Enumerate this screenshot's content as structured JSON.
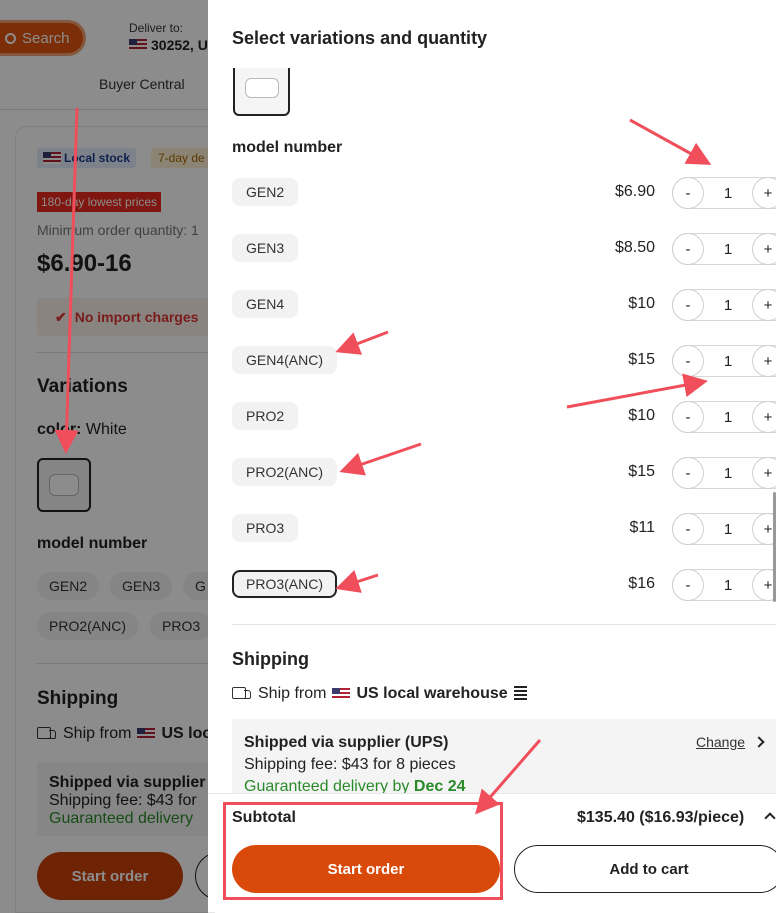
{
  "background": {
    "search_label": "Search",
    "deliver_label": "Deliver to:",
    "deliver_value": "30252, U",
    "buyer_central": "Buyer Central",
    "badge_local": "Local stock",
    "badge_days": "7-day de",
    "badge_lowest": "180-day lowest prices",
    "min_order": "Minimum order quantity: 1",
    "price_range": "$6.90-16",
    "no_import": "No import charges",
    "variations_title": "Variations",
    "color_label": "color:",
    "color_value": "White",
    "model_title": "model number",
    "chips": [
      "GEN2",
      "GEN3",
      "G",
      "PRO2(ANC)",
      "PRO3"
    ],
    "shipping_title": "Shipping",
    "ship_from_prefix": "Ship from",
    "ship_from_value": "US loc",
    "ship_line1": "Shipped via supplier",
    "ship_line2": "Shipping fee: $43 for",
    "ship_line3": "Guaranteed delivery",
    "start_order": "Start order"
  },
  "modal": {
    "title": "Select variations and quantity",
    "model_title": "model number",
    "variants": [
      {
        "name": "GEN2",
        "price": "$6.90",
        "qty": "1",
        "selected": false
      },
      {
        "name": "GEN3",
        "price": "$8.50",
        "qty": "1",
        "selected": false
      },
      {
        "name": "GEN4",
        "price": "$10",
        "qty": "1",
        "selected": false
      },
      {
        "name": "GEN4(ANC)",
        "price": "$15",
        "qty": "1",
        "selected": false
      },
      {
        "name": "PRO2",
        "price": "$10",
        "qty": "1",
        "selected": false
      },
      {
        "name": "PRO2(ANC)",
        "price": "$15",
        "qty": "1",
        "selected": false
      },
      {
        "name": "PRO3",
        "price": "$11",
        "qty": "1",
        "selected": false
      },
      {
        "name": "PRO3(ANC)",
        "price": "$16",
        "qty": "1",
        "selected": true
      }
    ],
    "stepper_minus": "-",
    "stepper_plus": "+",
    "shipping": {
      "title": "Shipping",
      "ship_from_prefix": "Ship from",
      "ship_from_value": "US local warehouse",
      "method": "Shipped via supplier (UPS)",
      "fee": "Shipping fee: $43 for 8 pieces",
      "delivery_prefix": "Guaranteed delivery by",
      "delivery_date": "Dec 24",
      "change_label": "Change"
    },
    "footer": {
      "subtotal_label": "Subtotal",
      "subtotal_value": "$135.40 ($16.93/piece)",
      "start_order": "Start order",
      "add_to_cart": "Add to cart"
    }
  },
  "colors": {
    "accent": "#d94a0a",
    "annotation_red": "#ef4e5a",
    "delivery_green": "#2a8a2a"
  }
}
